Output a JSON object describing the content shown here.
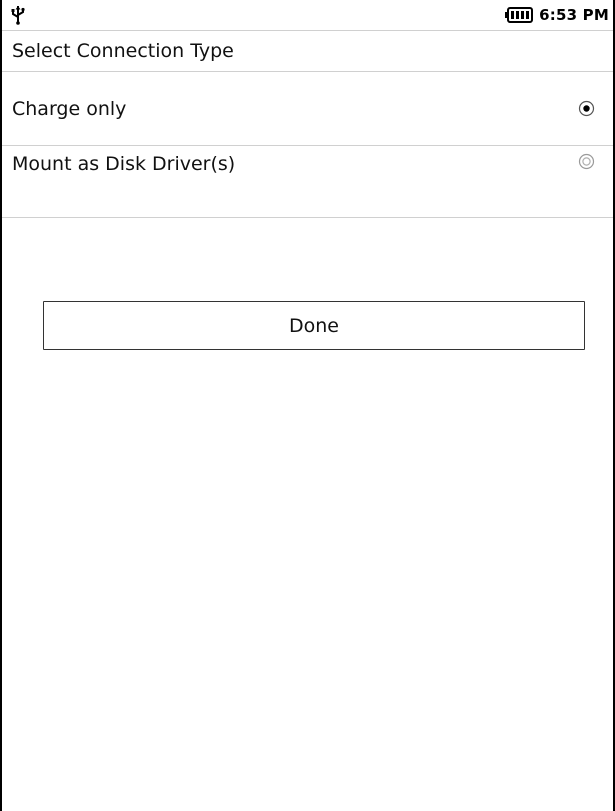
{
  "status_bar": {
    "usb_icon": "usb-icon",
    "battery_icon": "battery-icon",
    "time": "6:53 PM"
  },
  "dialog": {
    "title": "Select Connection Type",
    "options": [
      {
        "label": "Charge only",
        "selected": true
      },
      {
        "label": "Mount as Disk Driver(s)",
        "selected": false
      }
    ],
    "done_label": "Done"
  }
}
